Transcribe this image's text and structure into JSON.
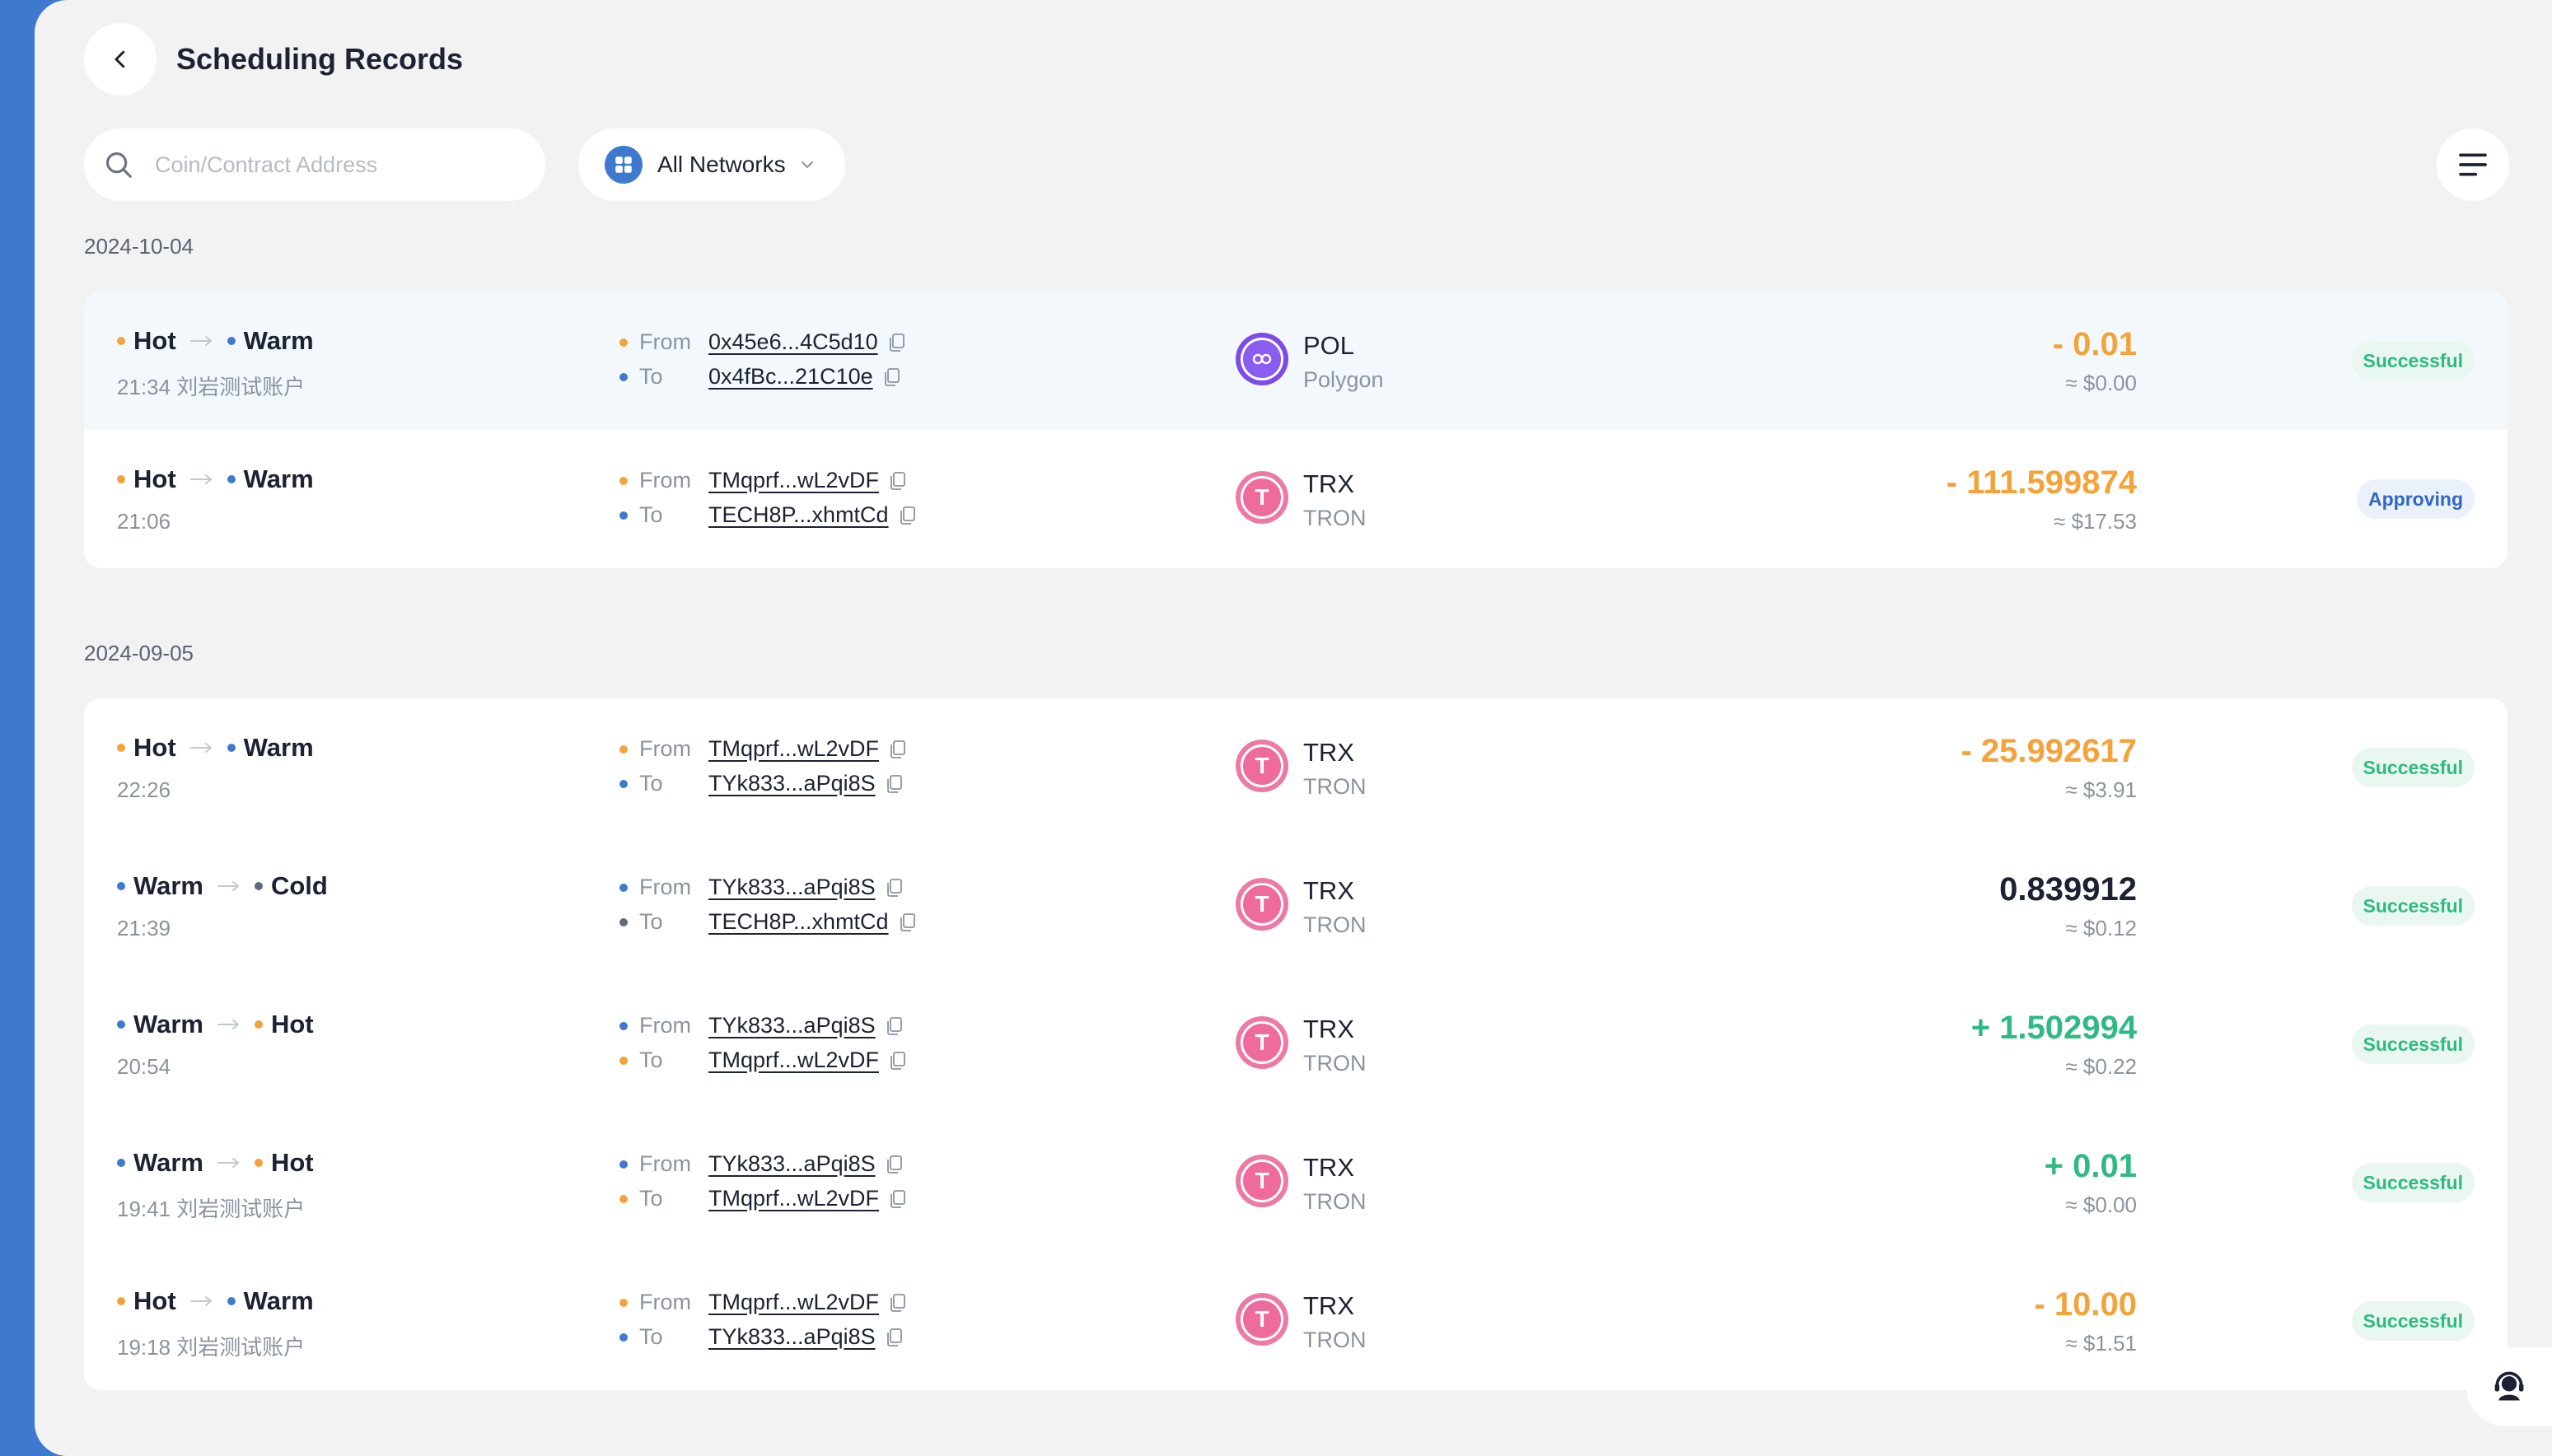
{
  "header": {
    "title": "Scheduling Records"
  },
  "search": {
    "placeholder": "Coin/Contract Address"
  },
  "network_filter": {
    "label": "All Networks"
  },
  "labels": {
    "from": "From",
    "to": "To"
  },
  "groups": [
    {
      "date": "2024-10-04",
      "rows": [
        {
          "from_wallet": "Hot",
          "to_wallet": "Warm",
          "time": "21:34 刘岩测试账户",
          "from_addr": "0x45e6...4C5d10",
          "to_addr": "0x4fBc...21C10e",
          "coin": "POL",
          "network": "Polygon",
          "amount": "- 0.01",
          "usd": "≈ $0.00",
          "status": "Successful"
        },
        {
          "from_wallet": "Hot",
          "to_wallet": "Warm",
          "time": "21:06",
          "from_addr": "TMqprf...wL2vDF",
          "to_addr": "TECH8P...xhmtCd",
          "coin": "TRX",
          "network": "TRON",
          "amount": "- 111.599874",
          "usd": "≈ $17.53",
          "status": "Approving"
        }
      ]
    },
    {
      "date": "2024-09-05",
      "rows": [
        {
          "from_wallet": "Hot",
          "to_wallet": "Warm",
          "time": "22:26",
          "from_addr": "TMqprf...wL2vDF",
          "to_addr": "TYk833...aPqi8S",
          "coin": "TRX",
          "network": "TRON",
          "amount": "- 25.992617",
          "usd": "≈ $3.91",
          "status": "Successful"
        },
        {
          "from_wallet": "Warm",
          "to_wallet": "Cold",
          "time": "21:39",
          "from_addr": "TYk833...aPqi8S",
          "to_addr": "TECH8P...xhmtCd",
          "coin": "TRX",
          "network": "TRON",
          "amount": "0.839912",
          "usd": "≈ $0.12",
          "status": "Successful"
        },
        {
          "from_wallet": "Warm",
          "to_wallet": "Hot",
          "time": "20:54",
          "from_addr": "TYk833...aPqi8S",
          "to_addr": "TMqprf...wL2vDF",
          "coin": "TRX",
          "network": "TRON",
          "amount": "+ 1.502994",
          "usd": "≈ $0.22",
          "status": "Successful"
        },
        {
          "from_wallet": "Warm",
          "to_wallet": "Hot",
          "time": "19:41 刘岩测试账户",
          "from_addr": "TYk833...aPqi8S",
          "to_addr": "TMqprf...wL2vDF",
          "coin": "TRX",
          "network": "TRON",
          "amount": "+ 0.01",
          "usd": "≈ $0.00",
          "status": "Successful"
        },
        {
          "from_wallet": "Hot",
          "to_wallet": "Warm",
          "time": "19:18 刘岩测试账户",
          "from_addr": "TMqprf...wL2vDF",
          "to_addr": "TYk833...aPqi8S",
          "coin": "TRX",
          "network": "TRON",
          "amount": "- 10.00",
          "usd": "≈ $1.51",
          "status": "Successful"
        }
      ]
    }
  ],
  "colors": {
    "accent": "#3f79cf",
    "hot": "#f3a33a",
    "warm": "#3f79cf",
    "cold": "#5f6b80",
    "negative": "#f3a33a",
    "positive": "#2fba83",
    "success": "#2fba83",
    "approving": "#2f68c0",
    "trx": "#ef6b9c",
    "pol": "#8a5cf0"
  },
  "icons": {
    "back": "chevron-left-icon",
    "search": "search-icon",
    "network": "grid-icon",
    "dropdown": "chevron-down-icon",
    "menu": "menu-icon",
    "copy": "copy-icon",
    "support": "customer-service-icon",
    "transfer": "arrow-right-icon"
  }
}
